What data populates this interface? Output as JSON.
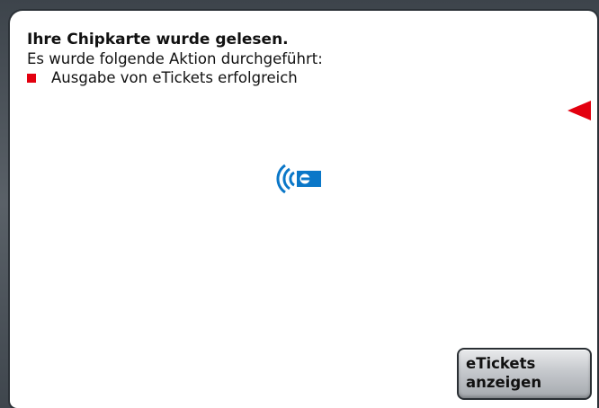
{
  "message": {
    "title": "Ihre Chipkarte wurde gelesen.",
    "subtitle": "Es wurde folgende Aktion durchgeführt:",
    "action": "Ausgabe von eTickets erfolgreich"
  },
  "button": {
    "line1": "eTickets",
    "line2": "anzeigen"
  },
  "icons": {
    "nfc": "nfc-eticket-icon",
    "bullet": "red-square-bullet-icon",
    "pointer": "red-arrow-pointer-icon"
  },
  "colors": {
    "accent_red": "#e3000f",
    "nfc_blue": "#0a77c8",
    "screen_background": "#ffffff",
    "bezel": "#4a5158"
  }
}
